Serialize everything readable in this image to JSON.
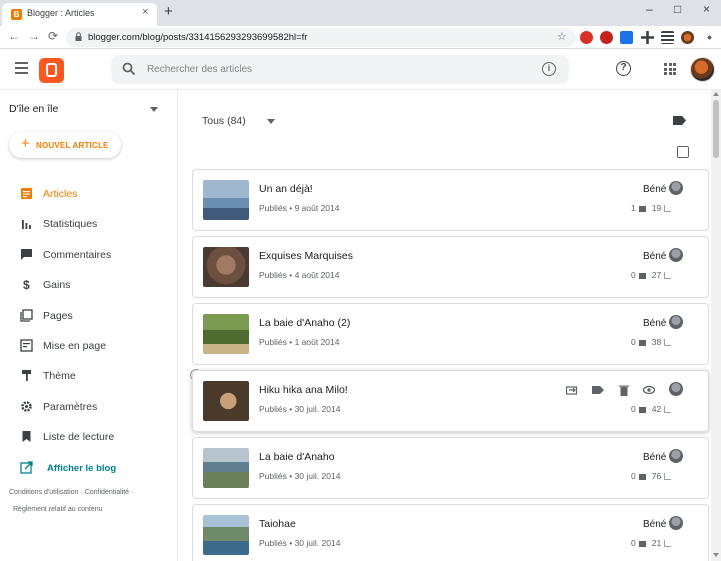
{
  "browser": {
    "tab_title": "Blogger : Articles",
    "tab_favicon": "B",
    "new_tab": "+",
    "close_tab": "×",
    "minimize": "–",
    "maximize": "□",
    "close_window": "×",
    "back": "←",
    "forward": "→",
    "reload": "⟳",
    "url": "blogger.com/blog/posts/3314156293293699582hl=fr",
    "bookmark_star": "☆"
  },
  "header": {
    "search_placeholder": "Rechercher des articles",
    "help": "?",
    "info": "i"
  },
  "sidebar": {
    "blog_name": "D'île en île",
    "new_post_plus": "+",
    "new_post_label": "NOUVEL ARTICLE",
    "items": [
      {
        "label": "Articles",
        "icon": "articles-icon",
        "active": true
      },
      {
        "label": "Statistiques",
        "icon": "stats-icon"
      },
      {
        "label": "Commentaires",
        "icon": "comments-icon"
      },
      {
        "label": "Gains",
        "icon": "dollar-icon"
      },
      {
        "label": "Pages",
        "icon": "pages-icon"
      },
      {
        "label": "Mise en page",
        "icon": "layout-icon"
      },
      {
        "label": "Thème",
        "icon": "theme-icon"
      },
      {
        "label": "Paramètres",
        "icon": "gear-icon"
      },
      {
        "label": "Liste de lecture",
        "icon": "bookmark-icon"
      }
    ],
    "view_blog": "Afficher le blog",
    "footer": {
      "terms": "Conditions d'utilisation",
      "sep1": "·",
      "privacy": "Confidentialité",
      "sep2": "·",
      "content_policy": "Règlement relatif au contenu"
    }
  },
  "main": {
    "filter_label": "Tous (84)",
    "posts": [
      {
        "title": "Un an déjà!",
        "meta": "Publiés • 9 août 2014",
        "author": "Béné",
        "comments": "1",
        "views": "19",
        "thumb": "#6b8fb0"
      },
      {
        "title": "Exquises Marquises",
        "meta": "Publiés • 4 août 2014",
        "author": "Béné",
        "comments": "0",
        "views": "27",
        "thumb": "#8a6a55"
      },
      {
        "title": "La baie d'Anaho (2)",
        "meta": "Publiés • 1 août 2014",
        "author": "Béné",
        "comments": "0",
        "views": "38",
        "thumb": "#5f7d3f"
      },
      {
        "title": "Hiku hika ana Milo!",
        "meta": "Publiés • 30 juil. 2014",
        "author": "",
        "comments": "0",
        "views": "42",
        "thumb": "#4a3a2c"
      },
      {
        "title": "La baie d'Anaho",
        "meta": "Publiés • 30 juil. 2014",
        "author": "Béné",
        "comments": "0",
        "views": "76",
        "thumb": "#7c8d8a"
      },
      {
        "title": "Taiohae",
        "meta": "Publiés • 30 juil. 2014",
        "author": "Béné",
        "comments": "0",
        "views": "21",
        "thumb": "#6f8a6a"
      }
    ]
  },
  "colors": {
    "accent": "#f57c00",
    "blogger_orange": "#ff5722",
    "link_teal": "#00838f"
  }
}
